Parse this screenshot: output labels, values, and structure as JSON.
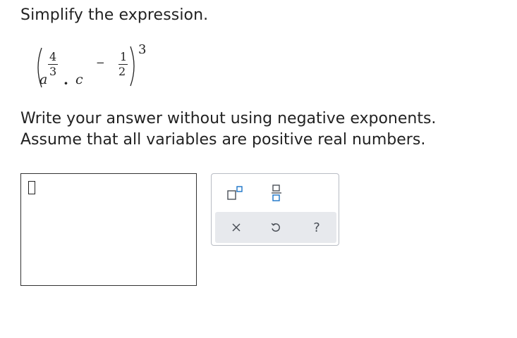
{
  "question": {
    "prompt": "Simplify the expression."
  },
  "expression": {
    "base_a": "a",
    "exp_a_numerator": "4",
    "exp_a_denominator": "3",
    "dot": "·",
    "base_c": "c",
    "exp_c_sign": "−",
    "exp_c_numerator": "1",
    "exp_c_denominator": "2",
    "outer_exponent": "3"
  },
  "instructions": {
    "line1": "Write your answer without using negative exponents.",
    "line2": "Assume that all variables are positive real numbers."
  },
  "answer": {
    "value": ""
  },
  "toolbar": {
    "row1": [
      {
        "name": "exponent-icon"
      },
      {
        "name": "fraction-icon"
      }
    ],
    "row2": [
      {
        "name": "clear-icon",
        "label": "×"
      },
      {
        "name": "undo-icon"
      },
      {
        "name": "help-icon",
        "label": "?"
      }
    ]
  },
  "colors": {
    "text": "#222222",
    "panel_border": "#b8bcc4",
    "toolbar_bg": "#e7e9ed",
    "icon": "#4a4f57",
    "accent": "#1a73c8"
  }
}
